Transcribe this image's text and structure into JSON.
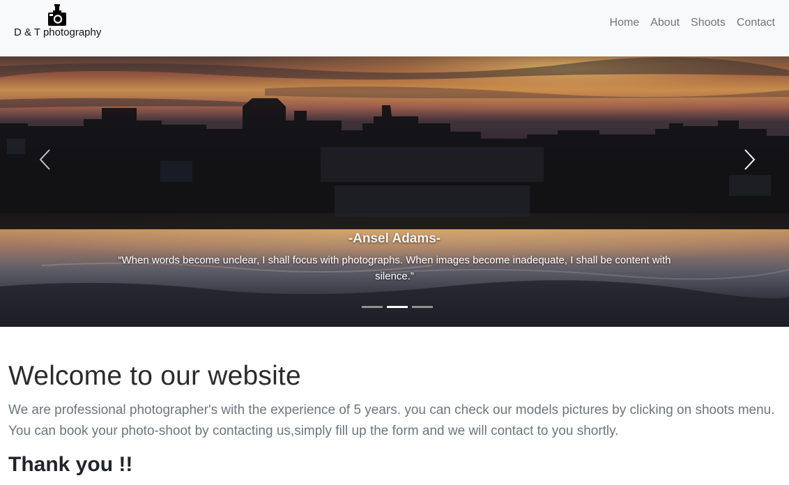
{
  "brand": {
    "logo_icon": "camera-flash-icon",
    "name": "D & T photography"
  },
  "nav": {
    "items": [
      {
        "label": "Home"
      },
      {
        "label": "About"
      },
      {
        "label": "Shoots"
      },
      {
        "label": "Contact"
      }
    ]
  },
  "carousel": {
    "prev_icon": "chevron-left-icon",
    "next_icon": "chevron-right-icon",
    "caption_title": "-Ansel Adams-",
    "caption_text": "“When words become unclear, I shall focus with photographs. When images become inadequate, I shall be content with silence.”",
    "slide_count": 3,
    "active_slide": 2
  },
  "content": {
    "welcome_heading": "Welcome to our website",
    "lead_text": "We are professional photographer's with the experience of 5 years. you can check our models pictures by clicking on shoots menu. You can book your photo-shoot by contacting us,simply fill up the form and we will contact to you shortly.",
    "thanks_heading": "Thank you !!"
  },
  "colors": {
    "navbar_bg": "#f8f9fa",
    "nav_link": "#6c757d",
    "caption_text": "#ffffff"
  }
}
